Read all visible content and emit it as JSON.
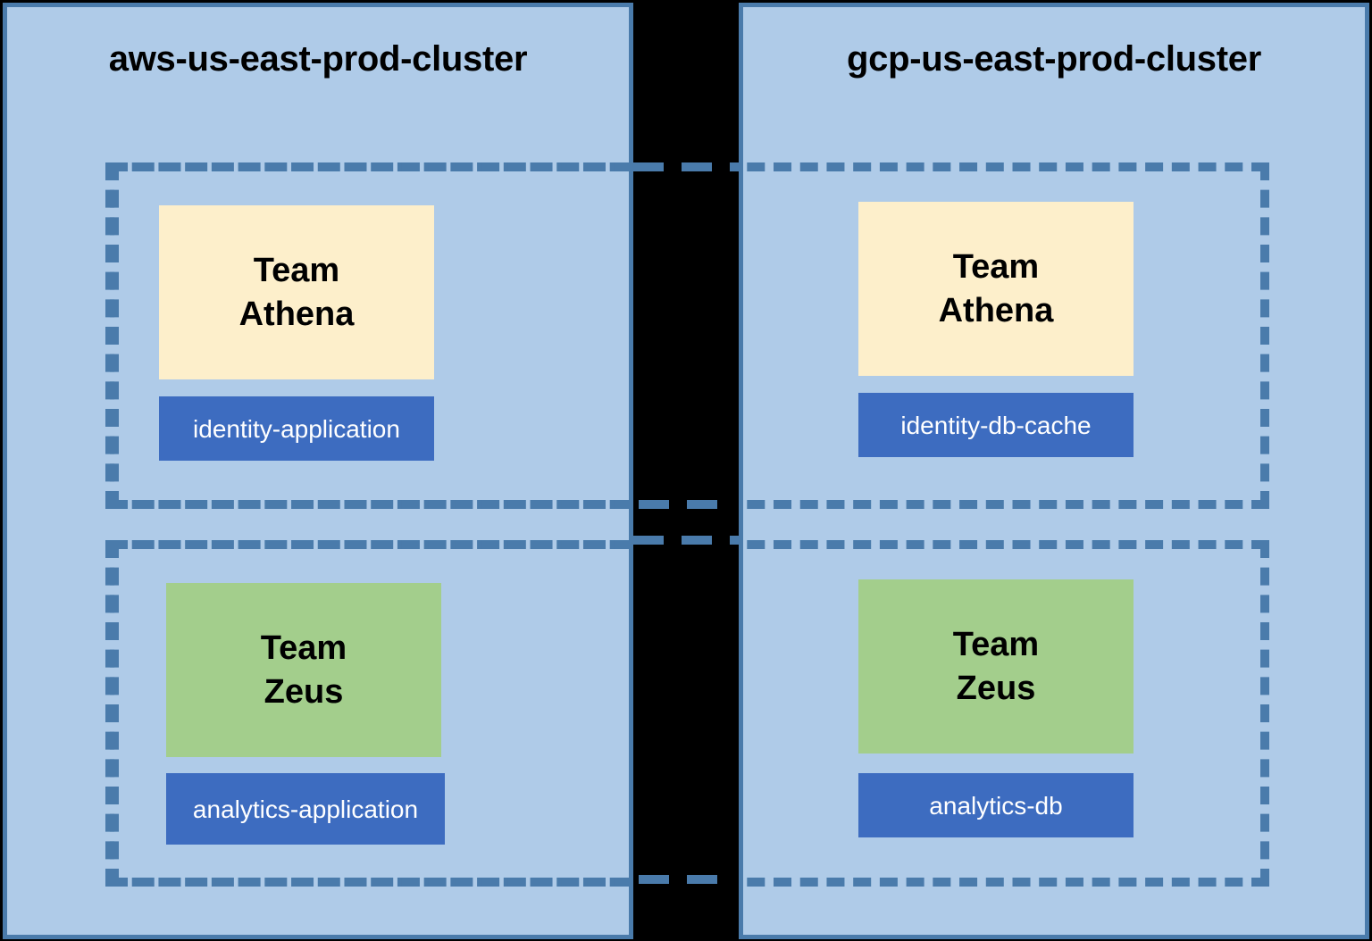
{
  "diagram": {
    "title_left": "aws-us-east-prod-cluster",
    "title_right": "gcp-us-east-prod-cluster",
    "colors": {
      "panel_fill": "#AFCBE8",
      "panel_border": "#4A7BAB",
      "divider_band": "#000000",
      "team_athena_fill": "#FDEFCB",
      "team_zeus_fill": "#A3CE8C",
      "service_fill": "#3D6CC0",
      "service_text": "#FFFFFF",
      "dashed_border": "#4A7BAB"
    }
  },
  "clusters": [
    {
      "name": "aws-us-east-prod-cluster",
      "teams": [
        {
          "team_line1": "Team",
          "team_line2": "Athena",
          "service_label": "identity-application"
        },
        {
          "team_line1": "Team",
          "team_line2": "Zeus",
          "service_label": "analytics-application"
        }
      ]
    },
    {
      "name": "gcp-us-east-prod-cluster",
      "teams": [
        {
          "team_line1": "Team",
          "team_line2": "Athena",
          "service_label": "identity-db-cache"
        },
        {
          "team_line1": "Team",
          "team_line2": "Zeus",
          "service_label": "analytics-db"
        }
      ]
    }
  ]
}
